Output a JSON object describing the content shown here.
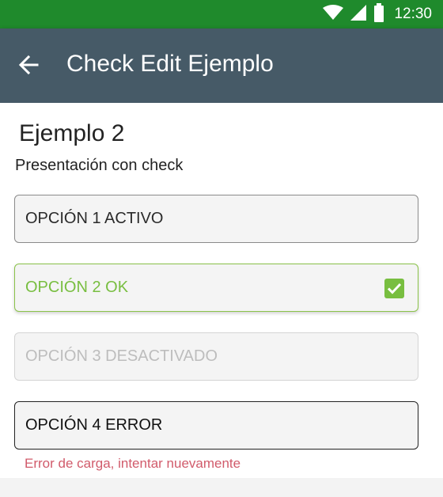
{
  "status_bar": {
    "time": "12:30",
    "icons": [
      "wifi-icon",
      "signal-icon",
      "battery-icon"
    ]
  },
  "app_bar": {
    "title": "Check Edit Ejemplo",
    "back_icon": "arrow-back-icon"
  },
  "section": {
    "title": "Ejemplo 2",
    "subtitle": "Presentación con check"
  },
  "options": [
    {
      "label": "OPCIÓN 1 ACTIVO",
      "state": "active"
    },
    {
      "label": "OPCIÓN 2 OK",
      "state": "ok",
      "checked": true
    },
    {
      "label": "OPCIÓN 3 DESACTIVADO",
      "state": "disabled"
    },
    {
      "label": "OPCIÓN 4 ERROR",
      "state": "error"
    }
  ],
  "error_message": "Error de carga, intentar nuevamente",
  "colors": {
    "status_bar": "#1f8a2c",
    "app_bar": "#465a67",
    "ok_green": "#78be40",
    "error_red": "#d15b6b",
    "disabled_gray": "#bdbdbd"
  }
}
